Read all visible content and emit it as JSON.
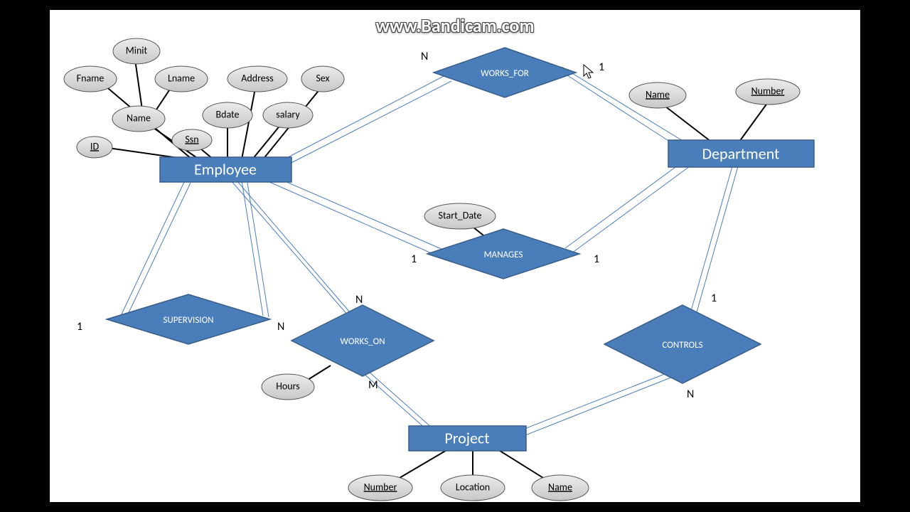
{
  "watermark": "www.Bandicam.com",
  "entities": {
    "employee": "Employee",
    "department": "Department",
    "project": "Project"
  },
  "relationships": {
    "works_for": "WORKS_FOR",
    "manages": "MANAGES",
    "supervision": "SUPERVISION",
    "works_on": "WORKS_ON",
    "controls": "CONTROLS"
  },
  "attributes": {
    "minit": "Minit",
    "fname": "Fname",
    "lname": "Lname",
    "address": "Address",
    "sex": "Sex",
    "name_emp": "Name",
    "bdate": "Bdate",
    "salary": "salary",
    "id": "ID",
    "ssn": "Ssn",
    "start_date": "Start_Date",
    "hours": "Hours",
    "dept_name": "Name",
    "dept_number": "Number",
    "proj_number": "Number",
    "proj_location": "Location",
    "proj_name": "Name"
  },
  "cardinality": {
    "one": "1",
    "n": "N",
    "m": "M"
  }
}
